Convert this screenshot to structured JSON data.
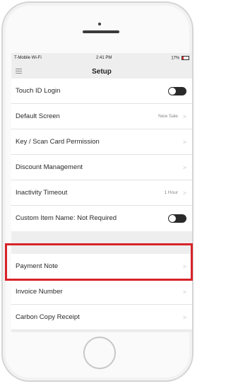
{
  "status_bar": {
    "carrier": "T-Mobile Wi-Fi",
    "time": "2:41 PM",
    "battery": "17%"
  },
  "nav": {
    "title": "Setup",
    "menu_icon": "hamburger-menu-icon"
  },
  "settings": {
    "touch_id": {
      "label": "Touch ID Login",
      "toggle_on": true
    },
    "default_screen": {
      "label": "Default Screen",
      "value": "New Sale"
    },
    "key_scan": {
      "label": "Key / Scan Card Permission"
    },
    "discount": {
      "label": "Discount Management"
    },
    "inactivity": {
      "label": "Inactivity Timeout",
      "value": "1 Hour"
    },
    "custom_item": {
      "label": "Custom Item Name: Not Required",
      "toggle_on": true
    },
    "payment_note": {
      "label": "Payment Note"
    },
    "invoice": {
      "label": "Invoice Number"
    },
    "carbon_copy": {
      "label": "Carbon Copy Receipt"
    }
  },
  "chevron_glyph": ">",
  "highlight_color": "#d8232a"
}
